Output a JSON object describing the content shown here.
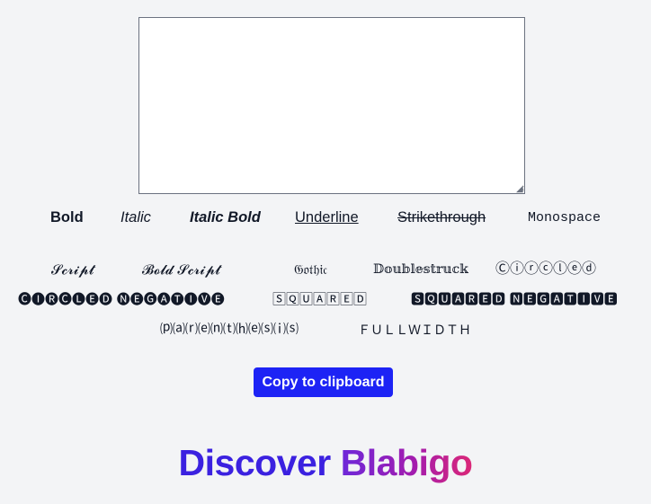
{
  "editor": {
    "value": "",
    "resize_grip_glyph": "◢"
  },
  "styles_row1": [
    {
      "label": "Bold"
    },
    {
      "label": "Italic"
    },
    {
      "label": "Italic Bold"
    },
    {
      "label": "Underline"
    },
    {
      "label": "Strikethrough"
    },
    {
      "label": "Monospace"
    }
  ],
  "styles_row2": [
    {
      "label": "𝓢𝓬𝓻𝓲𝓹𝓽"
    },
    {
      "label": "𝓑𝓸𝓵𝓭 𝓢𝓬𝓻𝓲𝓹𝓽"
    },
    {
      "label": "𝔊𝔬𝔱𝔥𝔦𝔠"
    },
    {
      "label": "𝔻𝕠𝕦𝕓𝕝𝕖𝕤𝕥𝕣𝕦𝕔𝕜"
    },
    {
      "label": "Ⓒⓘⓡⓒⓛⓔⓓ"
    }
  ],
  "styles_row3": [
    {
      "label": "🅒🅘🅡🅒🅛🅔🅓 🅝🅔🅖🅐🅣🅘🅥🅔"
    },
    {
      "label": "🅂🅀🅄🄰🅁🄴🄳"
    },
    {
      "label": "🆂🆀🆄🅰🆁🅴🅳 🅽🅴🅶🅰🆃🅸🆅🅴"
    }
  ],
  "styles_row4": [
    {
      "label": "⒫⒜⒭⒠⒩⒯⒣⒠⒮⒤⒮"
    },
    {
      "label": "ＦＵＬＬＷＩＤＴＨ"
    }
  ],
  "copy_button": {
    "label": "Copy to clipboard"
  },
  "brand": {
    "word1": "Discover",
    "word2": "Blabigo"
  },
  "colors": {
    "button": "#1d23f5",
    "brand_start": "#3b21e0",
    "brand_end": "#db2777"
  }
}
